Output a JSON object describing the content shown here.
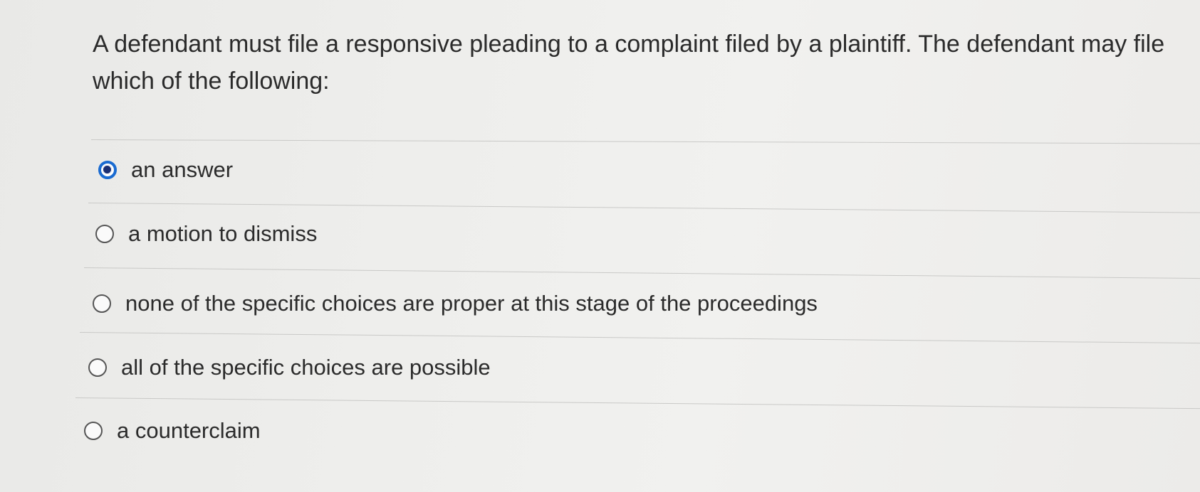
{
  "question": {
    "text": "A defendant must file a responsive pleading to a complaint filed by a plaintiff.  The defendant may file which of the following:"
  },
  "options": [
    {
      "label": "an answer",
      "selected": true
    },
    {
      "label": "a motion to dismiss",
      "selected": false
    },
    {
      "label": "none of the specific choices are proper at this stage of the proceedings",
      "selected": false
    },
    {
      "label": "all of the specific choices are possible",
      "selected": false
    },
    {
      "label": "a counterclaim",
      "selected": false
    }
  ],
  "colors": {
    "selected_radio": "#1a6bd1",
    "text": "#2b2b2b",
    "divider": "#c9c9c7"
  }
}
